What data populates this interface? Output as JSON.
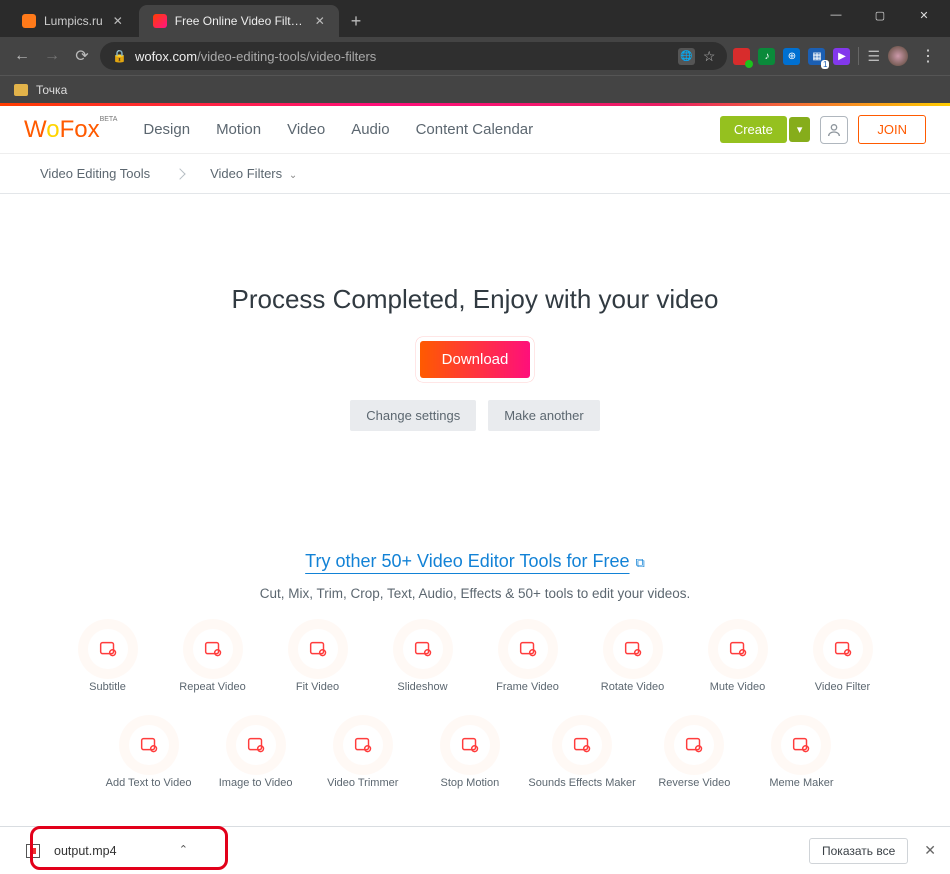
{
  "browser": {
    "tabs": [
      {
        "title": "Lumpics.ru"
      },
      {
        "title": "Free Online Video Filters | WoFo…"
      }
    ],
    "url_domain": "wofox.com",
    "url_path": "/video-editing-tools/video-filters",
    "bookmark_label": "Точка",
    "ext_badge": "1"
  },
  "header": {
    "logo_text_w": "W",
    "logo_text_o": "o",
    "logo_text_fox": "Fox",
    "logo_beta": "BETA",
    "nav": [
      "Design",
      "Motion",
      "Video",
      "Audio",
      "Content Calendar"
    ],
    "create": "Create",
    "join": "JOIN"
  },
  "breadcrumbs": {
    "a": "Video Editing Tools",
    "b": "Video Filters"
  },
  "main": {
    "headline": "Process Completed, Enjoy with your video",
    "download": "Download",
    "change_settings": "Change settings",
    "make_another": "Make another"
  },
  "try": {
    "link": "Try other 50+ Video Editor Tools for Free",
    "subtitle": "Cut, Mix, Trim, Crop, Text, Audio, Effects & 50+ tools to edit your videos."
  },
  "tools_row1": [
    "Subtitle",
    "Repeat Video",
    "Fit Video",
    "Slideshow",
    "Frame Video",
    "Rotate Video",
    "Mute Video",
    "Video Filter"
  ],
  "tools_row2": [
    "Add Text to Video",
    "Image to Video",
    "Video Trimmer",
    "Stop Motion",
    "Sounds Effects Maker",
    "Reverse Video",
    "Meme Maker"
  ],
  "shelf": {
    "file": "output.mp4",
    "show_all": "Показать все"
  }
}
